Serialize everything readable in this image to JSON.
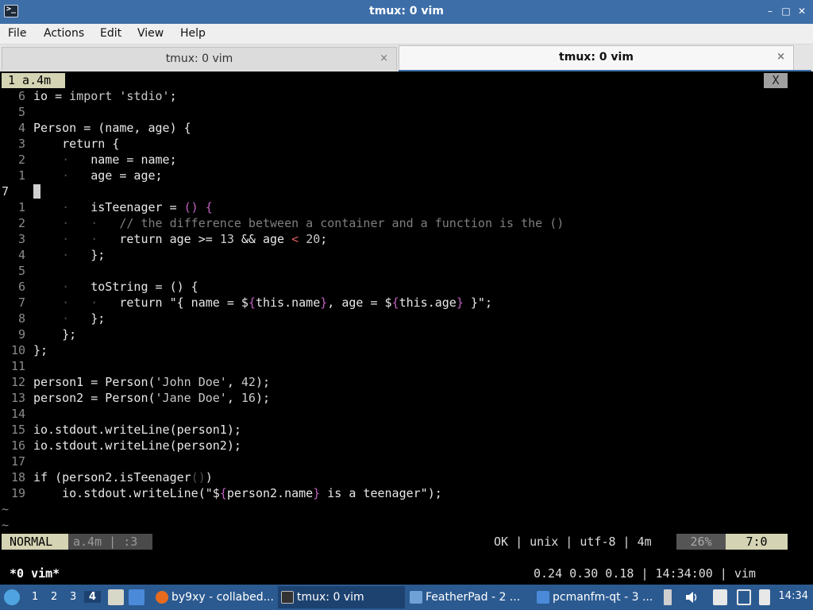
{
  "window": {
    "title": "tmux: 0 vim",
    "app_icon": ">_",
    "controls": {
      "minimize": "–",
      "maximize": "□",
      "close": "✕"
    }
  },
  "menubar": {
    "items": [
      "File",
      "Actions",
      "Edit",
      "View",
      "Help"
    ]
  },
  "tabs": [
    {
      "label": "tmux: 0 vim",
      "close": "×",
      "active": false
    },
    {
      "label": "tmux: 0 vim",
      "close": "×",
      "active": true
    }
  ],
  "vim": {
    "buffer_tab": "1  a.4m",
    "buffer_close": "X",
    "lines": [
      {
        "num": "6",
        "code": [
          [
            "io = ",
            ""
          ],
          [
            "import",
            "kw"
          ],
          [
            " 'stdio'",
            "str"
          ],
          [
            ";",
            ""
          ]
        ]
      },
      {
        "num": "5",
        "code": []
      },
      {
        "num": "4",
        "code": [
          [
            "Person = (name, age) {",
            ""
          ]
        ]
      },
      {
        "num": "3",
        "code": [
          [
            "    return {",
            ""
          ]
        ]
      },
      {
        "num": "2",
        "code": [
          [
            "    ",
            ""
          ],
          [
            "·",
            "g"
          ],
          [
            "   name = name;",
            ""
          ]
        ]
      },
      {
        "num": "1",
        "code": [
          [
            "    ",
            ""
          ],
          [
            "·",
            "g"
          ],
          [
            "   age = age;",
            ""
          ]
        ]
      },
      {
        "num": "7",
        "code": [],
        "cursor": true
      },
      {
        "num": "1",
        "code": [
          [
            "    ",
            ""
          ],
          [
            "·",
            "g"
          ],
          [
            "   isTeenager = ",
            ""
          ],
          [
            "() {",
            "br"
          ]
        ]
      },
      {
        "num": "2",
        "code": [
          [
            "    ",
            ""
          ],
          [
            "·",
            "g"
          ],
          [
            "   ",
            ""
          ],
          [
            "·",
            "g"
          ],
          [
            "   ",
            ""
          ],
          [
            "// the difference between a container and a function is the ()",
            "cm"
          ]
        ]
      },
      {
        "num": "3",
        "code": [
          [
            "    ",
            ""
          ],
          [
            "·",
            "g"
          ],
          [
            "   ",
            ""
          ],
          [
            "·",
            "g"
          ],
          [
            "   return age >= ",
            ""
          ],
          [
            "13",
            "num"
          ],
          [
            " && age ",
            ""
          ],
          [
            "<",
            "op"
          ],
          [
            " ",
            ""
          ],
          [
            "20",
            "num"
          ],
          [
            ";",
            ""
          ]
        ]
      },
      {
        "num": "4",
        "code": [
          [
            "    ",
            ""
          ],
          [
            "·",
            "g"
          ],
          [
            "   };",
            ""
          ]
        ]
      },
      {
        "num": "5",
        "code": []
      },
      {
        "num": "6",
        "code": [
          [
            "    ",
            ""
          ],
          [
            "·",
            "g"
          ],
          [
            "   toString = () {",
            ""
          ]
        ]
      },
      {
        "num": "7",
        "code": [
          [
            "    ",
            ""
          ],
          [
            "·",
            "g"
          ],
          [
            "   ",
            ""
          ],
          [
            "·",
            "g"
          ],
          [
            "   return \"{ name = $",
            ""
          ],
          [
            "{",
            "br"
          ],
          [
            "this.name",
            ""
          ],
          [
            "}",
            "br"
          ],
          [
            ", age = $",
            ""
          ],
          [
            "{",
            "br"
          ],
          [
            "this.age",
            ""
          ],
          [
            "}",
            "br"
          ],
          [
            " }\";",
            ""
          ]
        ]
      },
      {
        "num": "8",
        "code": [
          [
            "    ",
            ""
          ],
          [
            "·",
            "g"
          ],
          [
            "   };",
            ""
          ]
        ]
      },
      {
        "num": "9",
        "code": [
          [
            "    };",
            ""
          ]
        ]
      },
      {
        "num": "10",
        "code": [
          [
            "};",
            ""
          ]
        ]
      },
      {
        "num": "11",
        "code": []
      },
      {
        "num": "12",
        "code": [
          [
            "person1 = Person(",
            ""
          ],
          [
            "'John Doe'",
            "str"
          ],
          [
            ", ",
            ""
          ],
          [
            "42",
            "num"
          ],
          [
            ");",
            ""
          ]
        ]
      },
      {
        "num": "13",
        "code": [
          [
            "person2 = Person(",
            ""
          ],
          [
            "'Jane Doe'",
            "str"
          ],
          [
            ", ",
            ""
          ],
          [
            "16",
            "num"
          ],
          [
            ");",
            ""
          ]
        ]
      },
      {
        "num": "14",
        "code": []
      },
      {
        "num": "15",
        "code": [
          [
            "io.stdout.writeLine(person1);",
            ""
          ]
        ]
      },
      {
        "num": "16",
        "code": [
          [
            "io.stdout.writeLine(person2);",
            ""
          ]
        ]
      },
      {
        "num": "17",
        "code": []
      },
      {
        "num": "18",
        "code": [
          [
            "if (person2.isTeenager",
            ""
          ],
          [
            "()",
            "g"
          ],
          [
            ")",
            ""
          ]
        ]
      },
      {
        "num": "19",
        "code": [
          [
            "    io.stdout.writeLine(\"$",
            ""
          ],
          [
            "{",
            "br"
          ],
          [
            "person2.name",
            ""
          ],
          [
            "}",
            "br"
          ],
          [
            " is a teenager\");",
            ""
          ]
        ]
      }
    ],
    "tildes": [
      "~",
      "~"
    ],
    "status": {
      "mode": "NORMAL",
      "file": "a.4m  |  :3",
      "right": "OK  |  unix  |  utf-8  |  4m",
      "percent": "26%",
      "position": "7:0"
    }
  },
  "tmux": {
    "window": "*0 vim*",
    "right": "0.24 0.30 0.18  |  14:34:00  |  vim"
  },
  "taskbar": {
    "workspaces": [
      "1",
      "2",
      "3",
      "4"
    ],
    "active_workspace": "4",
    "tasks": [
      {
        "label": "by9xy - collabed...",
        "icon": "firefox-icon",
        "color": "#e66b1f"
      },
      {
        "label": "tmux: 0 vim",
        "icon": "terminal-icon",
        "color": "#333333",
        "active": true
      },
      {
        "label": "FeatherPad - 2 ...",
        "icon": "featherpad-icon",
        "color": "#6fa0d6"
      },
      {
        "label": "pcmanfm-qt - 3 ...",
        "icon": "folder-icon",
        "color": "#4a8ad8"
      }
    ],
    "clock": "14:34"
  }
}
